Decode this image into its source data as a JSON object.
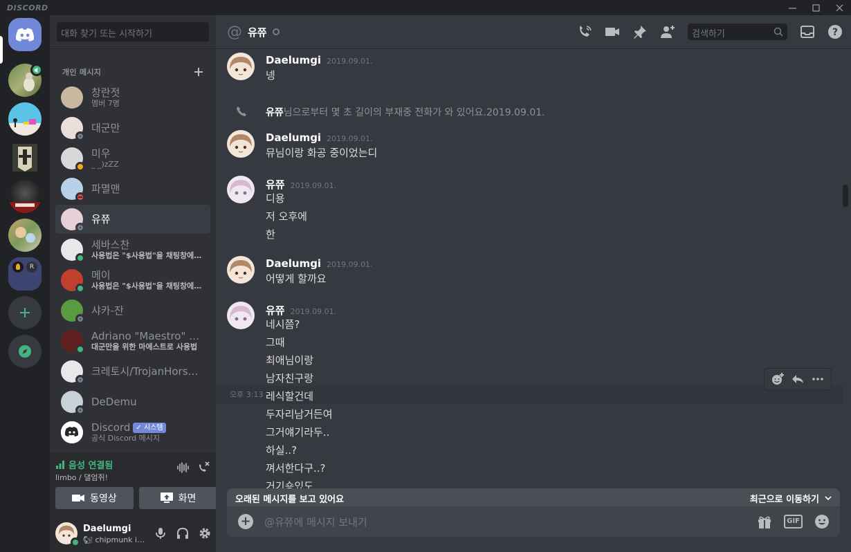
{
  "app": {
    "brand": "DISCORD"
  },
  "sidebar": {
    "search_placeholder": "대화 찾기 또는 시작하기",
    "dm_header": "개인 메시지",
    "dms": [
      {
        "name": "창란젓",
        "sub": "멤버 7명",
        "status": "none",
        "active": false
      },
      {
        "name": "대군만",
        "sub": "",
        "status": "offline",
        "active": false
      },
      {
        "name": "미우",
        "sub": "_ _)zZZ",
        "status": "idle",
        "active": false
      },
      {
        "name": "파멸맨",
        "sub": "",
        "status": "dnd",
        "active": false
      },
      {
        "name": "유쮸",
        "sub": "",
        "status": "offline",
        "active": true
      },
      {
        "name": "세바스찬",
        "sub": "사용법은 \"$사용법\"을 채팅창에 쳐주세요!",
        "status": "online",
        "active": false,
        "bold": true
      },
      {
        "name": "메이",
        "sub": "사용법은 \"$사용법\"을 채팅창에 쳐주세요!",
        "status": "online",
        "active": false,
        "bold": true
      },
      {
        "name": "샤카-잔",
        "sub": "",
        "status": "offline",
        "active": false
      },
      {
        "name": "Adriano \"Maestro\" Ciocca",
        "sub": "대군만을 위한 마에스트로 사용법",
        "status": "online",
        "active": false,
        "bold": true
      },
      {
        "name": "크레토시/TrojanHorse/pwn",
        "sub": "",
        "status": "offline",
        "active": false
      },
      {
        "name": "DeDemu",
        "sub": "",
        "status": "offline",
        "active": false
      },
      {
        "name": "Discord",
        "sub": "공식 Discord 메시지",
        "status": "none",
        "active": false,
        "tag": "✓ 시스템"
      }
    ]
  },
  "voice": {
    "status": "음성 연결됨",
    "channel": "limbo / 댈엄쥐!",
    "video_label": "동영상",
    "screen_label": "화면"
  },
  "user": {
    "name": "Daelumgi",
    "status_text": "🐿 chipmunk is cute"
  },
  "chat": {
    "title": "유쮸",
    "search_placeholder": "검색하기",
    "groups": [
      {
        "author": "Daelumgi",
        "time": "2019.09.01.",
        "lines": [
          "넹"
        ]
      },
      {
        "call": true,
        "caller": "유쮸",
        "text": "님으로부터 몇 초 길이의 부재중 전화가 와 있어요.",
        "time": "2019.09.01."
      },
      {
        "author": "Daelumgi",
        "time": "2019.09.01.",
        "lines": [
          "뮤님이랑 화공 중이었는디"
        ]
      },
      {
        "author": "유쮸",
        "time": "2019.09.01.",
        "lines": [
          "디용",
          "저 오후에",
          "한"
        ]
      },
      {
        "author": "Daelumgi",
        "time": "2019.09.01.",
        "lines": [
          "어떻게 할까요"
        ]
      },
      {
        "author": "유쮸",
        "time": "2019.09.01.",
        "lines": [
          "네시쯤?",
          "그때",
          "최애님이랑",
          "남자친구랑",
          "레식할건데",
          "두자리남거든여",
          "그거얘기라두..",
          "하실..?",
          "껴서한다구..?",
          "거기숑있도"
        ]
      }
    ],
    "hover_time": "오후 3:13",
    "old_banner": "오래된 메시지를 보고 있어요",
    "jump_label": "최근으로 이동하기",
    "composer_placeholder": "@유쮸에 메시지 보내기",
    "gif_label": "GIF"
  },
  "colors": {
    "online": "#43b581",
    "idle": "#faa61a",
    "dnd": "#f04747",
    "offline": "#747f8d",
    "blurple": "#7289da"
  }
}
